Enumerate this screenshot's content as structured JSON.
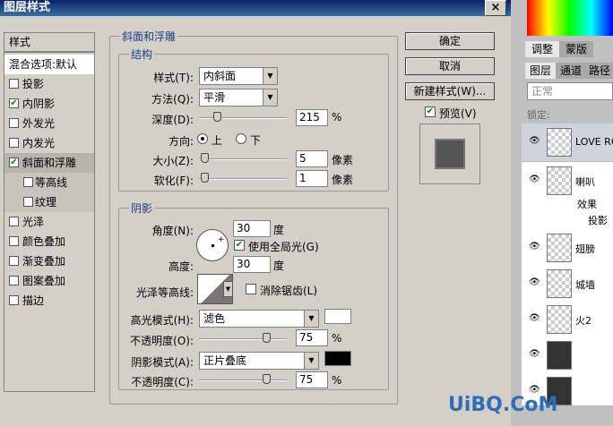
{
  "window": {
    "title": "图层样式",
    "close": "×"
  },
  "left_list": {
    "header": "样式",
    "items": [
      {
        "label": "混合选项:默认",
        "check": null
      },
      {
        "label": "投影",
        "check": false
      },
      {
        "label": "内阴影",
        "check": true
      },
      {
        "label": "外发光",
        "check": false
      },
      {
        "label": "内发光",
        "check": false
      },
      {
        "label": "斜面和浮雕",
        "check": true
      },
      {
        "label": "等高线",
        "check": false
      },
      {
        "label": "纹理",
        "check": false
      },
      {
        "label": "光泽",
        "check": false
      },
      {
        "label": "颜色叠加",
        "check": false
      },
      {
        "label": "渐变叠加",
        "check": false
      },
      {
        "label": "图案叠加",
        "check": false
      },
      {
        "label": "描边",
        "check": false
      }
    ]
  },
  "bevel": {
    "group_title": "斜面和浮雕",
    "structure_title": "结构",
    "style_label": "样式(T):",
    "style_value": "内斜面",
    "technique_label": "方法(Q):",
    "technique_value": "平滑",
    "depth_label": "深度(D):",
    "depth_value": "215",
    "depth_unit": "%",
    "depth_slider": 0.2,
    "direction_label": "方向:",
    "dir_up": "上",
    "dir_down": "下",
    "size_label": "大小(Z):",
    "size_value": "5",
    "size_unit": "像素",
    "soften_label": "软化(F):",
    "soften_value": "1",
    "soften_unit": "像素"
  },
  "shading": {
    "title": "阴影",
    "angle_label": "角度(N):",
    "angle_value": "30",
    "angle_unit": "度",
    "global_light": "使用全局光(G)",
    "altitude_label": "高度:",
    "altitude_value": "30",
    "altitude_unit": "度",
    "gloss_label": "光泽等高线:",
    "antialias": "消除锯齿(L)",
    "highlight_label": "高光模式(H):",
    "highlight_value": "滤色",
    "highlight_color": "#ffffff",
    "hl_opacity_label": "不透明度(O):",
    "hl_opacity_value": "75",
    "hl_opacity_unit": "%",
    "shadow_label": "阴影模式(A):",
    "shadow_value": "正片叠底",
    "shadow_color": "#000000",
    "sh_opacity_label": "不透明度(C):",
    "sh_opacity_value": "75",
    "sh_opacity_unit": "%"
  },
  "buttons": {
    "ok": "确定",
    "cancel": "取消",
    "new_style": "新建样式(W)...",
    "preview": "预览(V)"
  },
  "panel": {
    "tabs": [
      "调整",
      "蒙版"
    ],
    "tabs2": [
      "图层",
      "通道",
      "路径"
    ],
    "blend": "正常",
    "lock": "锁定:",
    "layers": [
      "LOVE RO",
      "喇叭",
      "效果",
      "投影",
      "翅膀",
      "城墙",
      "火2"
    ]
  },
  "watermark": "UiBQ.CoM"
}
